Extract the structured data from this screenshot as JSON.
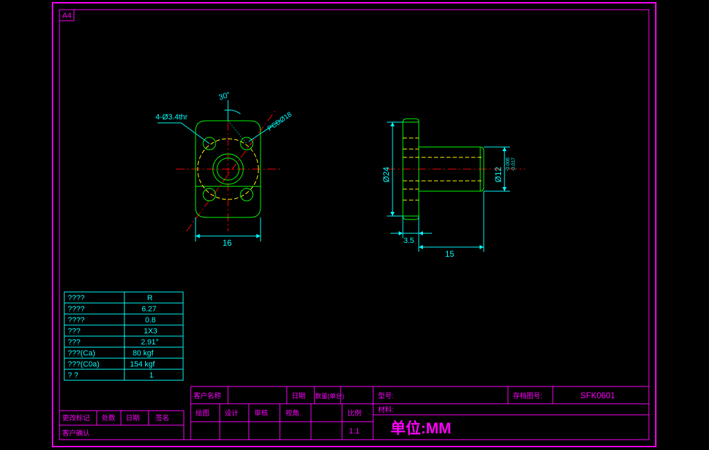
{
  "sheet_label": "A4",
  "drawing_number": "SFK0601",
  "unit_label": "单位:MM",
  "scale": "1:1",
  "dimensions": {
    "hole_note": "4-Ø3.4thr",
    "angle": "30°",
    "pcd": "PCDØ18",
    "width": "16",
    "flange_thk": "3.5",
    "length": "15",
    "od": "Ø24",
    "shaft": "Ø12",
    "shaft_tol1": "-0.006",
    "shaft_tol2": "-0.017"
  },
  "spec_table": {
    "rows": [
      {
        "k": "????",
        "v": "R"
      },
      {
        "k": "????",
        "v": "6.27"
      },
      {
        "k": "????",
        "v": "0.8"
      },
      {
        "k": "???",
        "v": "1X3"
      },
      {
        "k": "???",
        "v": "2.91°"
      },
      {
        "k": "???(Ca)",
        "v": "80 kgf"
      },
      {
        "k": "???(C0a)",
        "v": "154 kgf"
      },
      {
        "k": "?  ?",
        "v": "1"
      }
    ]
  },
  "title_block": {
    "row1": [
      "客户名称",
      "日期",
      "数量(单台)",
      "型号:",
      "存档图号:"
    ],
    "row2": [
      "绘图",
      "设计",
      "审核",
      "视角.",
      "比例"
    ],
    "material": "材料:",
    "rev": [
      "更改标记",
      "处数",
      "日期",
      "签名"
    ],
    "confirm": "客户确认"
  }
}
